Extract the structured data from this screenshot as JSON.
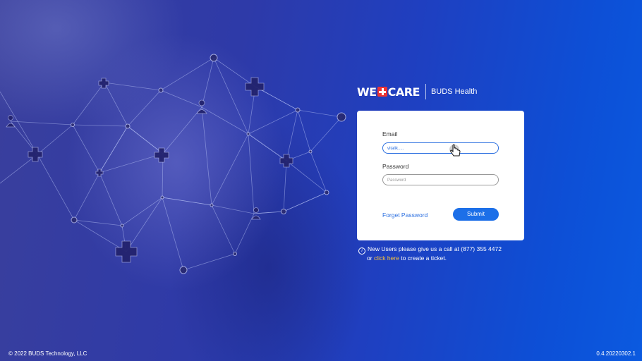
{
  "brand": {
    "we_text": "WE",
    "care_text": "CARE",
    "product_name": "BUDS Health",
    "cross_color": "#e33333"
  },
  "login": {
    "email_label": "Email",
    "email_value": "vitalik.....",
    "password_label": "Password",
    "password_placeholder": "Password",
    "forget_password": "Forget Password",
    "submit_label": "Submit"
  },
  "notice": {
    "info_icon": "info-icon",
    "line1": "New Users please give us a call at (877) 355 4472",
    "line2_prefix": "or",
    "link_text": "click here",
    "line2_suffix": "to create a ticket."
  },
  "footer": {
    "copyright": "© 2022 BUDS Technology, LLC",
    "version": "0.4.20220302.1"
  },
  "colors": {
    "accent": "#1c6fe8",
    "link_highlight": "#f7c23b"
  }
}
